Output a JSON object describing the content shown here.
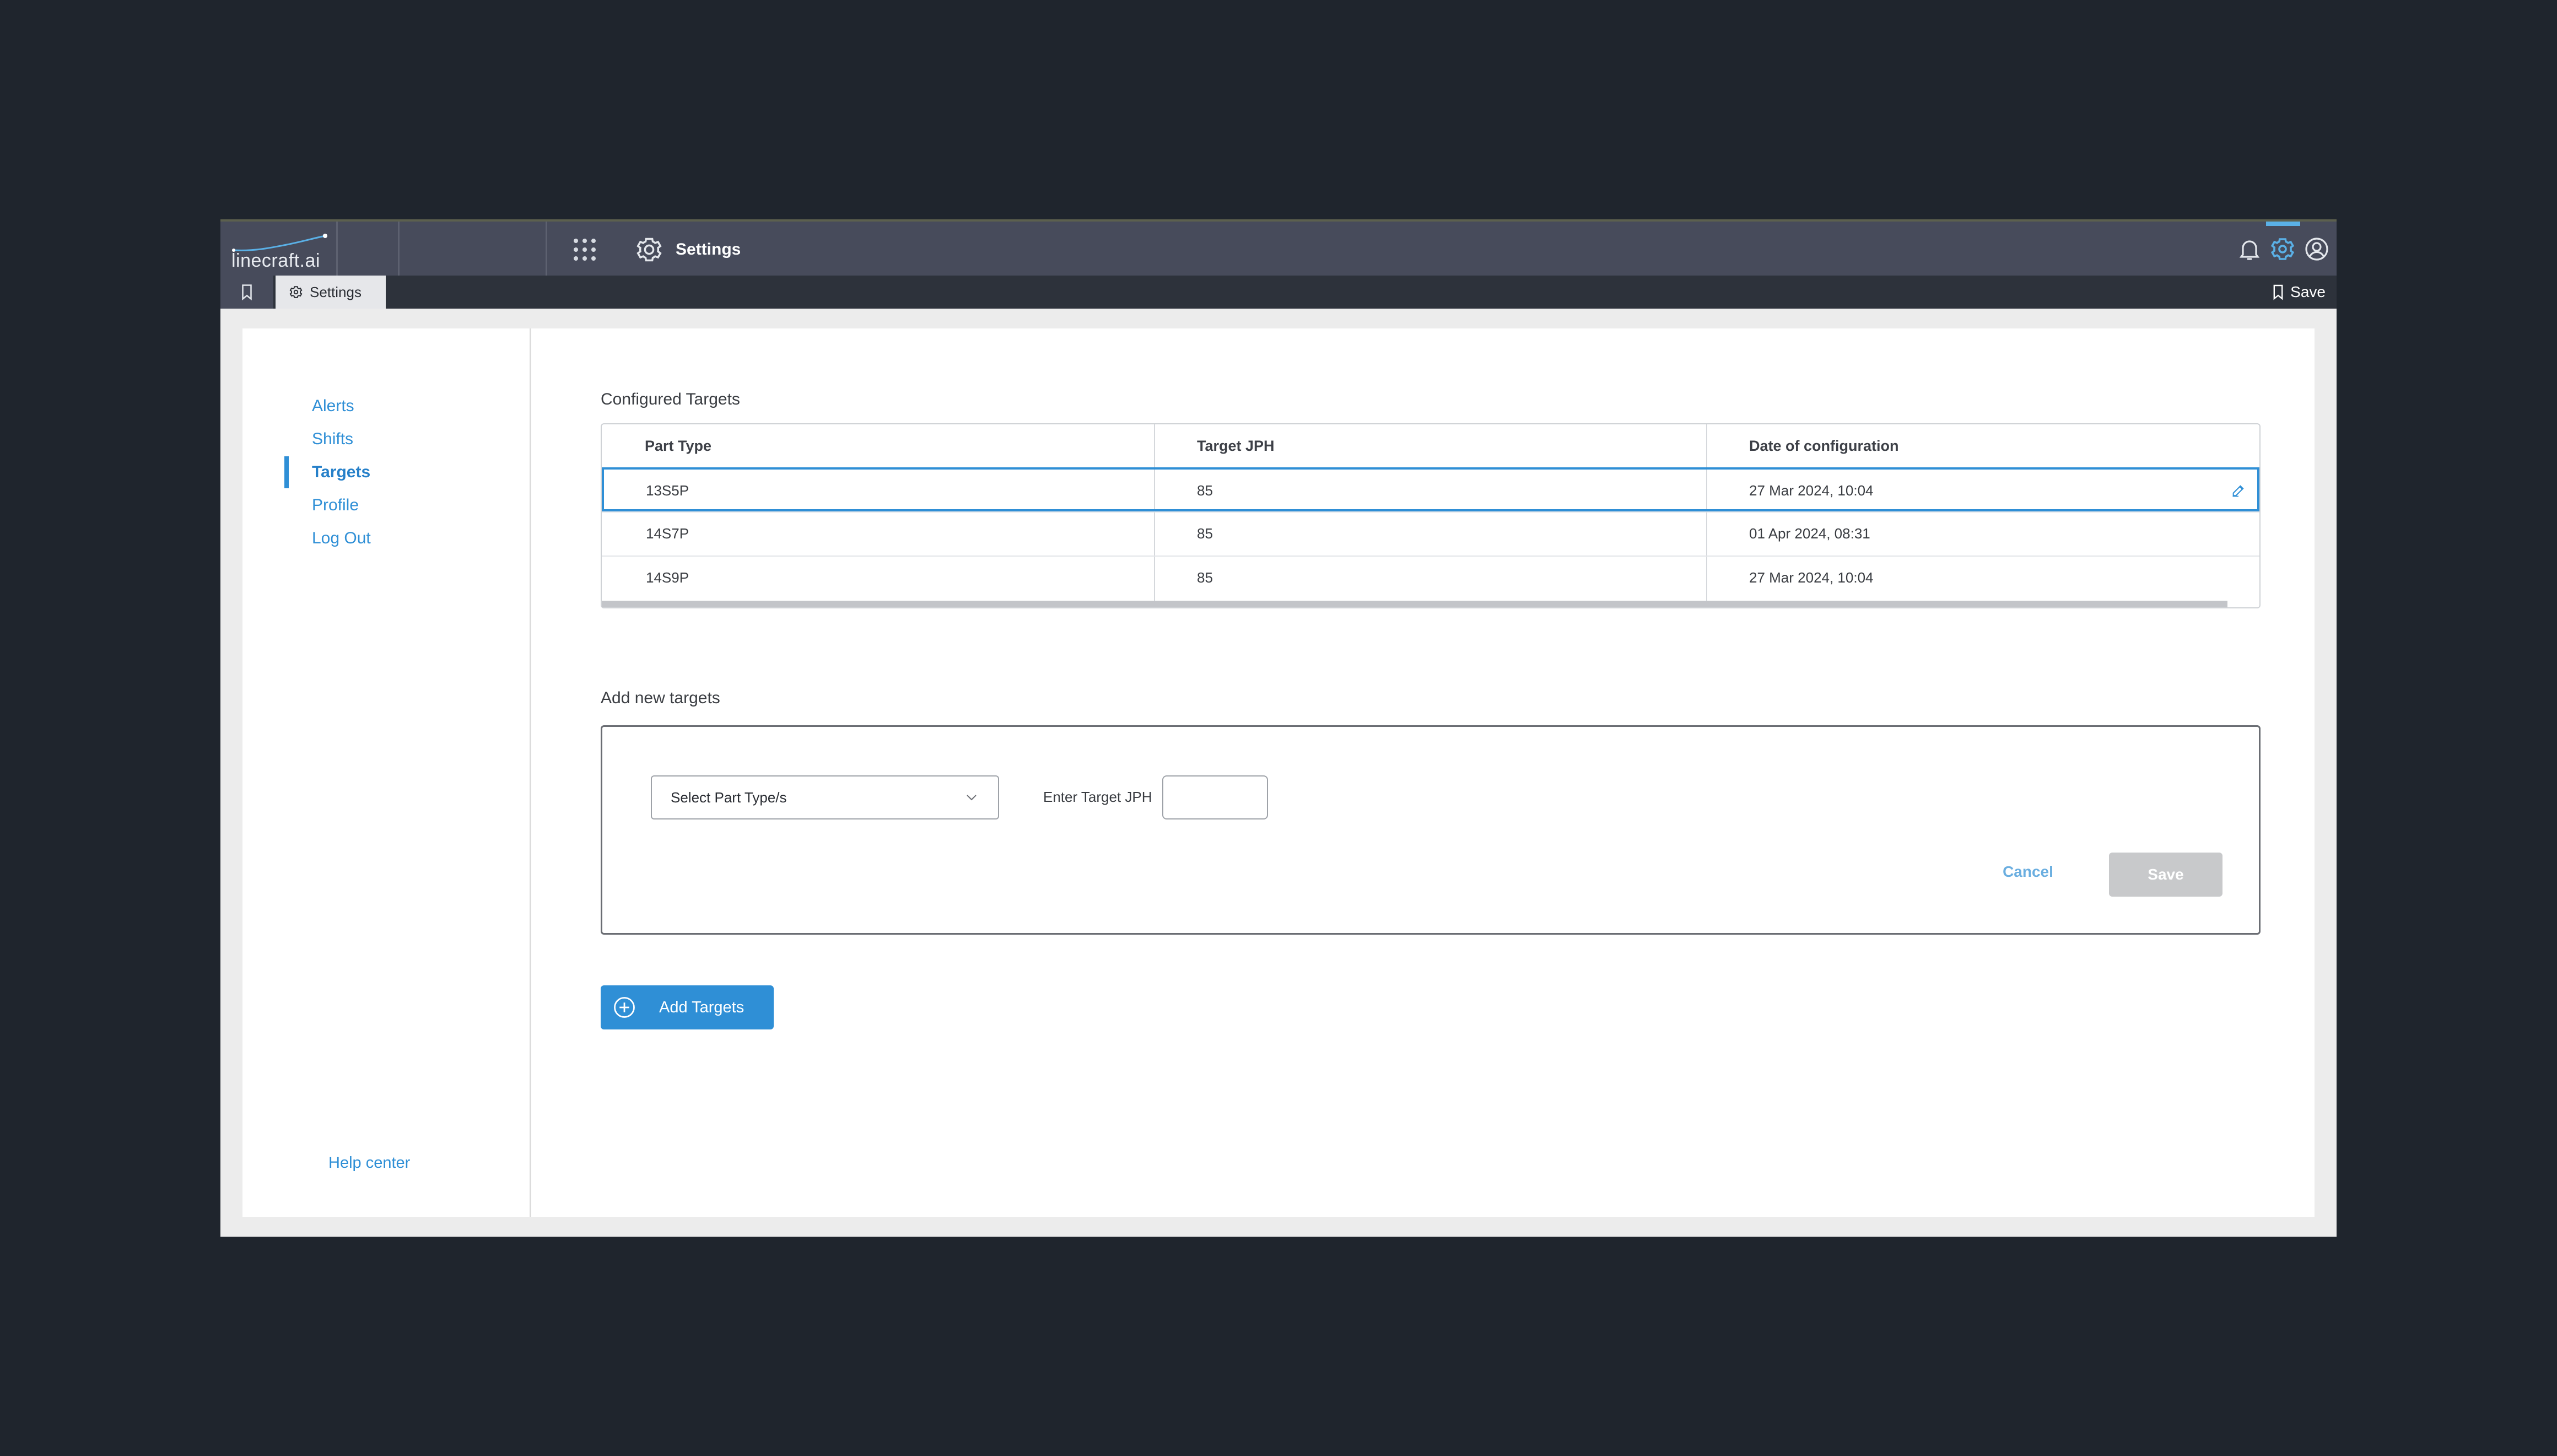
{
  "header": {
    "brand": "linecraft.ai",
    "title": "Settings",
    "icons": [
      "apps-grid-icon",
      "gear-icon",
      "bell-icon",
      "settings-icon",
      "user-icon"
    ]
  },
  "tabbar": {
    "tab_label": "Settings",
    "save_label": "Save"
  },
  "sidebar": {
    "items": [
      {
        "label": "Alerts"
      },
      {
        "label": "Shifts"
      },
      {
        "label": "Targets",
        "active": true
      },
      {
        "label": "Profile"
      },
      {
        "label": "Log Out"
      }
    ],
    "help": "Help center"
  },
  "configured": {
    "title": "Configured Targets",
    "columns": [
      "Part Type",
      "Target JPH",
      "Date of configuration"
    ],
    "rows": [
      {
        "part": "13S5P",
        "jph": "85",
        "date": "27 Mar 2024, 10:04"
      },
      {
        "part": "14S7P",
        "jph": "85",
        "date": "01 Apr 2024, 08:31"
      },
      {
        "part": "14S9P",
        "jph": "85",
        "date": "27 Mar 2024, 10:04"
      }
    ]
  },
  "add_form": {
    "title": "Add new targets",
    "select_placeholder": "Select Part Type/s",
    "jph_label": "Enter Target JPH",
    "jph_value": "",
    "cancel_label": "Cancel",
    "save_label": "Save"
  },
  "add_button": "Add Targets",
  "colors": {
    "accent": "#2f8fd6",
    "topbar": "#474b5b",
    "background": "#1f252d"
  }
}
